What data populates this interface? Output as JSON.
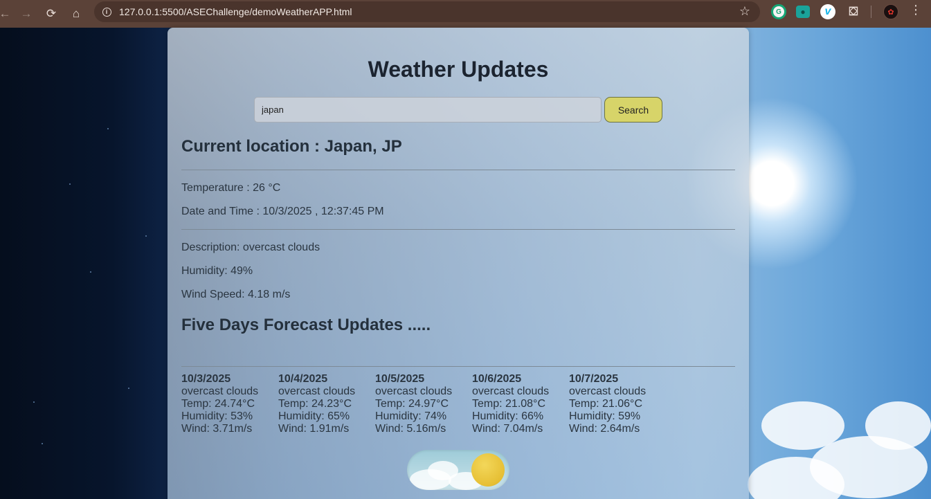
{
  "browser": {
    "url": "127.0.0.1:5500/ASEChallenge/demoWeatherAPP.html",
    "extensions": [
      "grammarly-icon",
      "chat-extension-icon",
      "vimeo-icon",
      "puzzle-icon",
      "profile-icon"
    ]
  },
  "app": {
    "title": "Weather Updates",
    "search": {
      "value": "japan",
      "button_label": "Search"
    },
    "current": {
      "location": "Current location : Japan, JP",
      "temperature": "Temperature : 26 °C",
      "datetime": "Date and Time : 10/3/2025 , 12:37:45 PM",
      "description": "Description: overcast clouds",
      "humidity": "Humidity: 49%",
      "wind": "Wind Speed: 4.18 m/s"
    },
    "forecast_title": "Five Days Forecast Updates .....",
    "forecast": [
      {
        "date": "10/3/2025",
        "desc": "overcast clouds",
        "temp": "Temp: 24.74°C",
        "humidity": "Humidity: 53%",
        "wind": "Wind: 3.71m/s"
      },
      {
        "date": "10/4/2025",
        "desc": "overcast clouds",
        "temp": "Temp: 24.23°C",
        "humidity": "Humidity: 65%",
        "wind": "Wind: 1.91m/s"
      },
      {
        "date": "10/5/2025",
        "desc": "overcast clouds",
        "temp": "Temp: 24.97°C",
        "humidity": "Humidity: 74%",
        "wind": "Wind: 5.16m/s"
      },
      {
        "date": "10/6/2025",
        "desc": "overcast clouds",
        "temp": "Temp: 21.08°C",
        "humidity": "Humidity: 66%",
        "wind": "Wind: 7.04m/s"
      },
      {
        "date": "10/7/2025",
        "desc": "overcast clouds",
        "temp": "Temp: 21.06°C",
        "humidity": "Humidity: 59%",
        "wind": "Wind: 2.64m/s"
      }
    ],
    "theme_toggle": {
      "mode": "day"
    }
  },
  "colors": {
    "search_button": "#d7d469",
    "browser_frame": "#5b4238",
    "sun": "#e6bf34"
  }
}
